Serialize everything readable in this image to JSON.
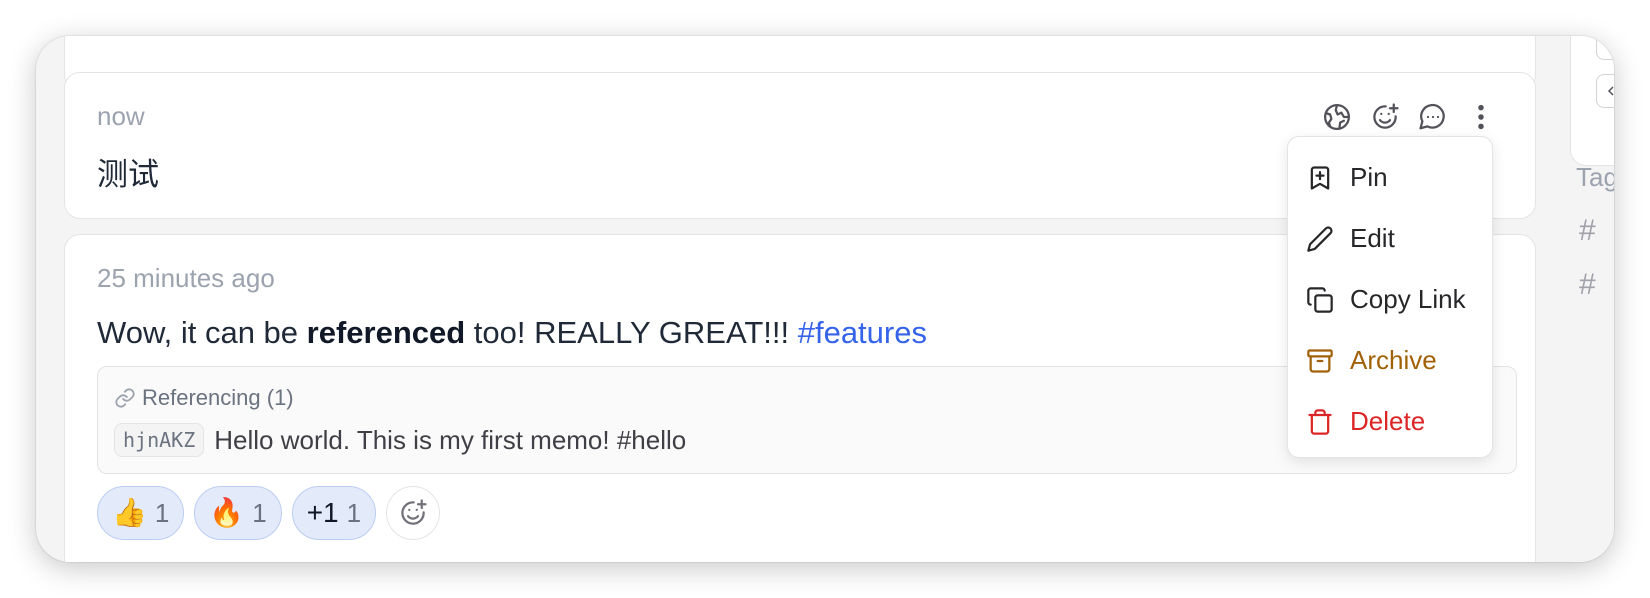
{
  "memo_current": {
    "time": "now",
    "content": "测试",
    "actions": [
      "visibility-icon",
      "add-reaction-icon",
      "comment-icon",
      "more-vertical-icon"
    ]
  },
  "more_menu": {
    "items": [
      {
        "label": "Pin",
        "icon": "bookmark-plus-icon"
      },
      {
        "label": "Edit",
        "icon": "pencil-icon"
      },
      {
        "label": "Copy Link",
        "icon": "copy-icon"
      },
      {
        "label": "Archive",
        "icon": "archive-icon"
      },
      {
        "label": "Delete",
        "icon": "trash-icon"
      }
    ]
  },
  "memo_referenced": {
    "time": "25 minutes ago",
    "content": {
      "pre": "Wow, it can be ",
      "bold": "referenced",
      "mid": " too! REALLY GREAT!!! ",
      "tag": "#features"
    },
    "referencing": {
      "label": "Referencing (1)",
      "id": "hjnAKZ",
      "text": "Hello world. This is my first memo! #hello"
    },
    "reactions": [
      {
        "emoji": "👍",
        "count": "1"
      },
      {
        "emoji": "🔥",
        "count": "1"
      },
      {
        "emoji": "+1",
        "count": "1"
      }
    ]
  },
  "sidebar": {
    "tags_title": "Tags",
    "tag_prefix": "#"
  },
  "colors": {
    "accent": "#3563e9",
    "archive": "#a16207",
    "delete": "#dc2626",
    "reaction_bg": "#e3ebfb"
  }
}
